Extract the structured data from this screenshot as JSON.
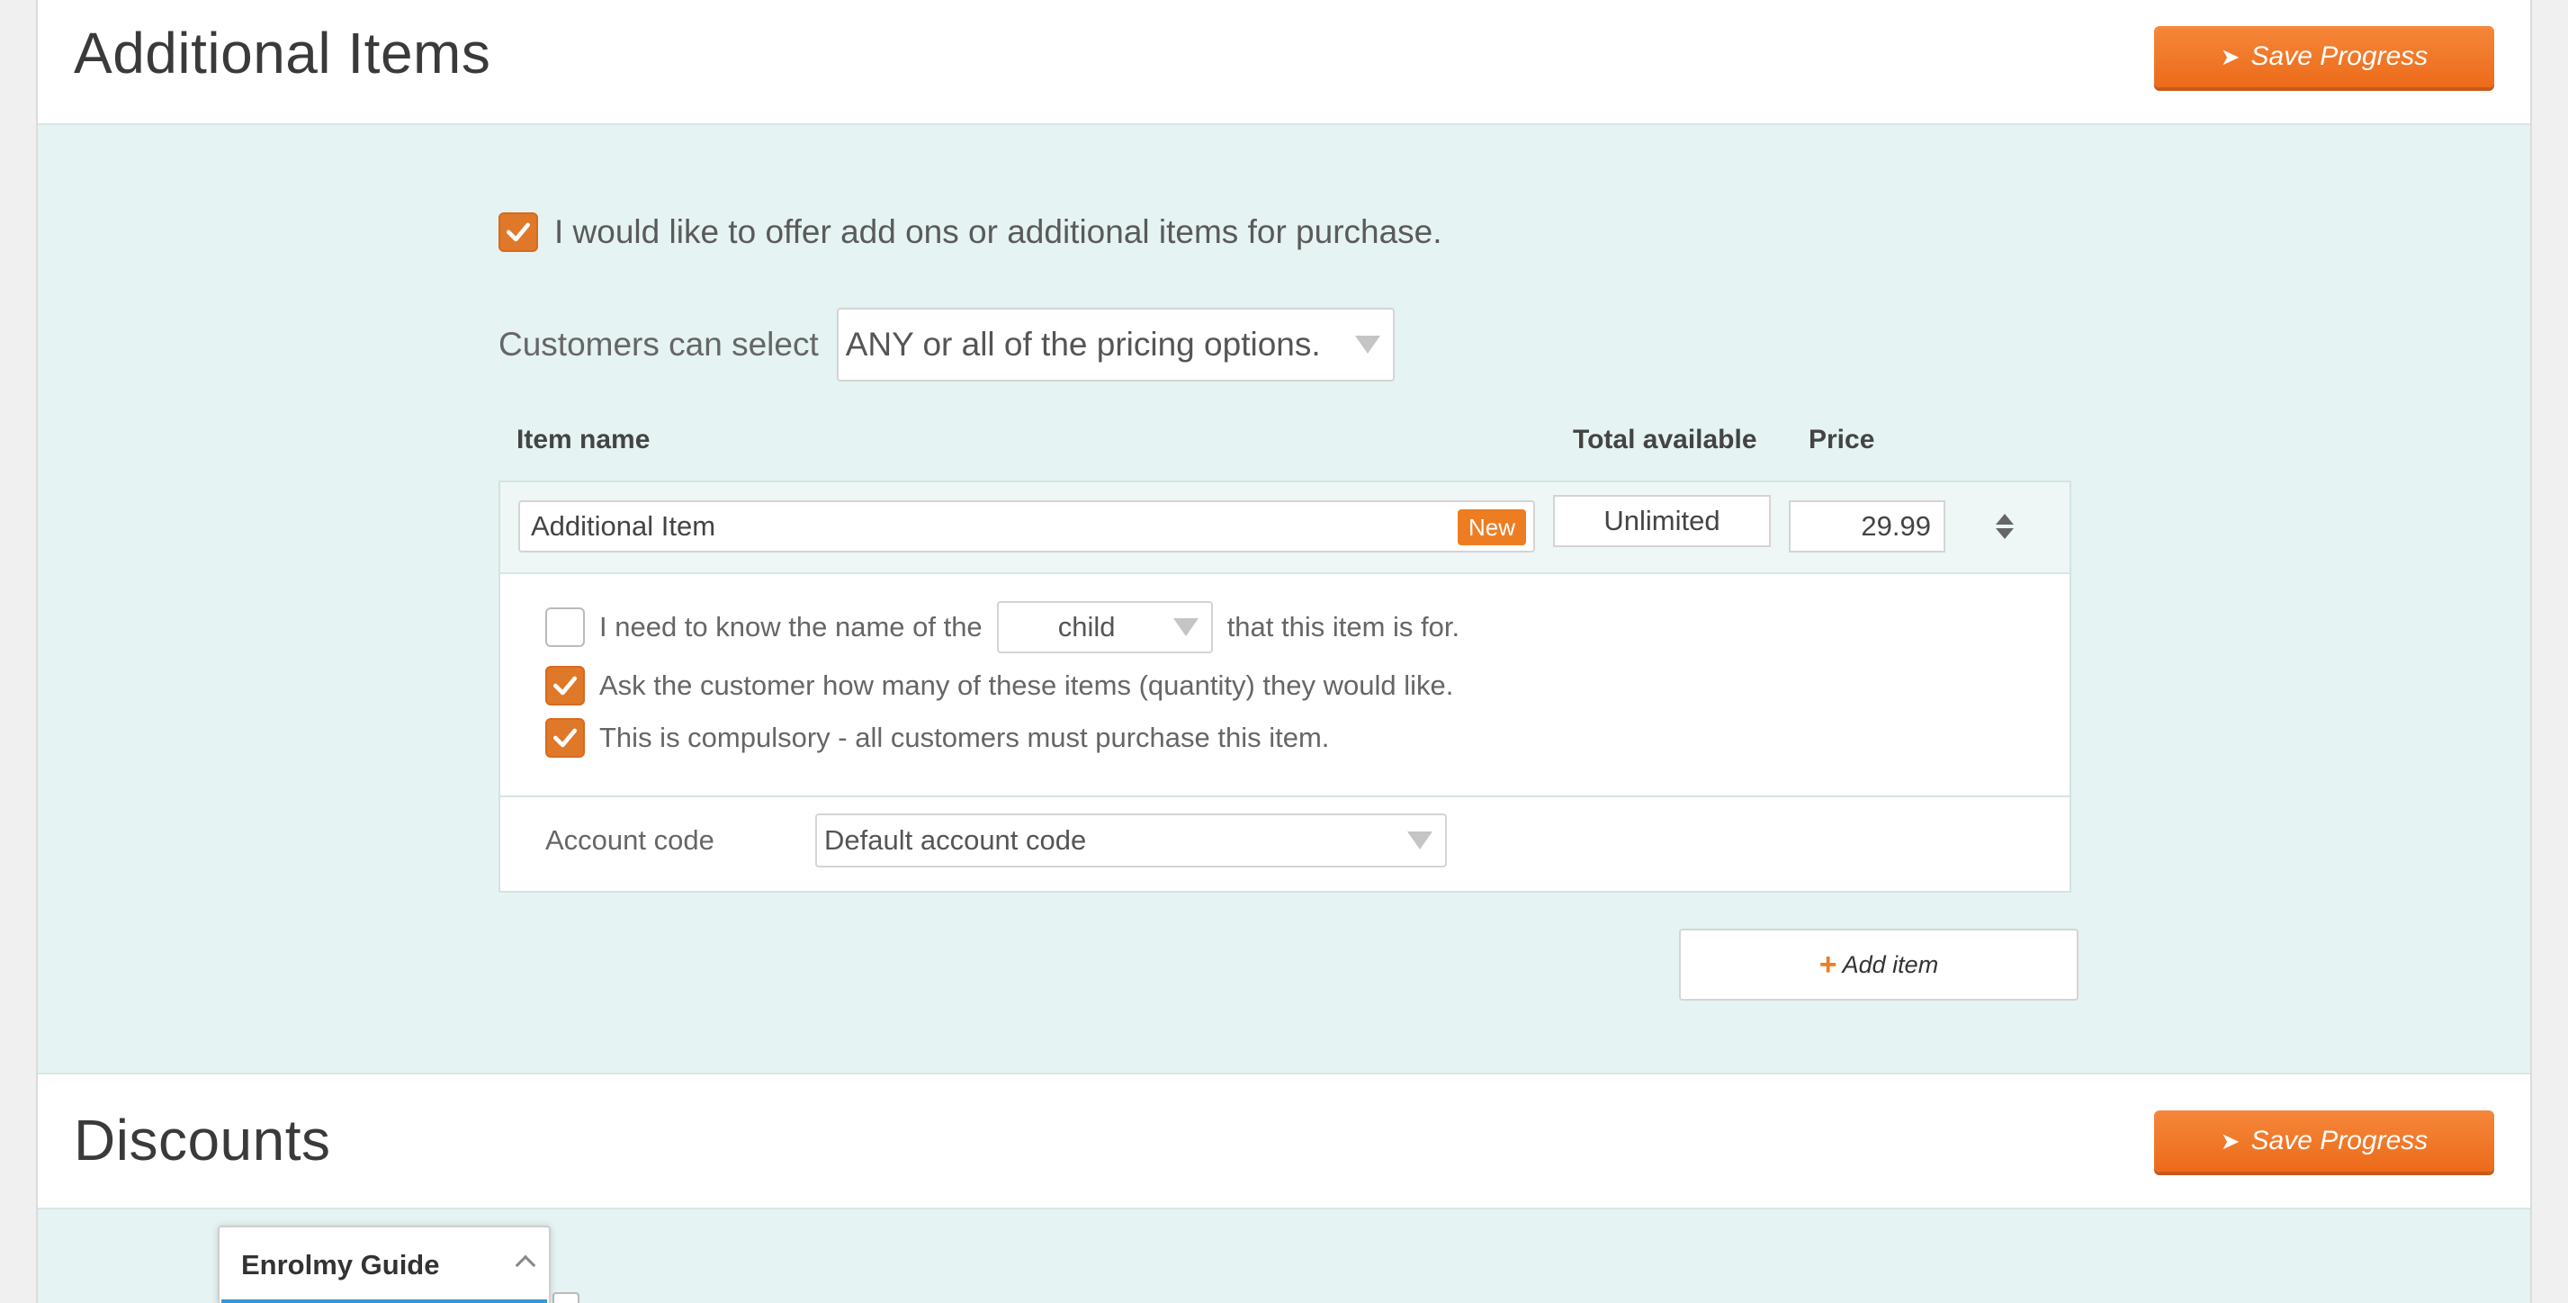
{
  "sections": {
    "additional_items": {
      "title": "Additional Items",
      "save_label": "Save Progress"
    },
    "discounts": {
      "title": "Discounts",
      "save_label": "Save Progress"
    }
  },
  "offer": {
    "checked": true,
    "label": "I would like to offer add ons or additional items for purchase."
  },
  "pricing": {
    "label": "Customers can select",
    "selected": "ANY or all of the pricing options."
  },
  "table": {
    "headers": {
      "item_name": "Item name",
      "total_available": "Total available",
      "price": "Price"
    },
    "item": {
      "name": "Additional Item",
      "badge": "New",
      "total": "Unlimited",
      "price": "29.99",
      "options": {
        "name_prefix": "I need to know the name of the",
        "name_select": "child",
        "name_suffix": "that this item is for.",
        "name_checked": false,
        "quantity_label": "Ask the customer how many of these items (quantity) they would like.",
        "quantity_checked": true,
        "compulsory_label": "This is compulsory - all customers must purchase this item.",
        "compulsory_checked": true
      },
      "account": {
        "label": "Account code",
        "selected": "Default account code"
      }
    }
  },
  "add_item_label": "Add item",
  "guide": {
    "title": "Enrolmy Guide"
  },
  "colors": {
    "accent": "#ee7d22",
    "checkbox": "#e0782a",
    "panel_bg": "#e5f3f2",
    "guide_bar": "#3a97d4"
  }
}
